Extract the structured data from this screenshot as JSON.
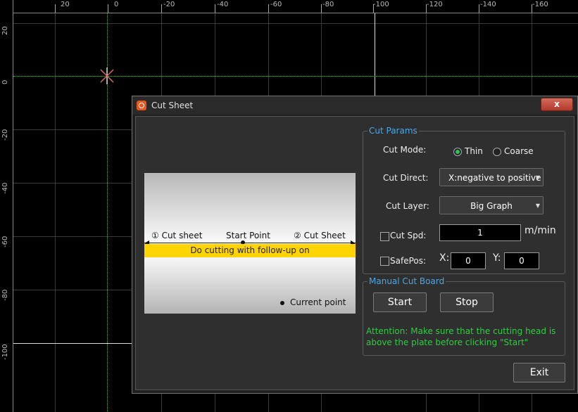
{
  "ruler": {
    "top_labels": [
      "20",
      "0",
      "-20",
      "-40",
      "-60",
      "-80",
      "-100",
      "-120",
      "-140",
      "-160"
    ],
    "left_labels": [
      "20",
      "0",
      "-20",
      "-40",
      "-60",
      "-80",
      "-100"
    ]
  },
  "dialog": {
    "title": "Cut Sheet",
    "close": "x",
    "preview": {
      "cut_sheet_1": "① Cut sheet",
      "start_point": "Start Point",
      "cut_sheet_2": "② Cut Sheet",
      "band_text": "Do cutting with follow-up on",
      "current_point": "Current point"
    },
    "cut_params": {
      "title": "Cut Params",
      "cut_mode_label": "Cut Mode:",
      "mode_thin": "Thin",
      "mode_coarse": "Coarse",
      "cut_direct_label": "Cut Direct:",
      "cut_direct_value": "X:negative to positive",
      "cut_layer_label": "Cut Layer:",
      "cut_layer_value": "Big Graph",
      "cut_spd_label": "Cut Spd:",
      "cut_spd_value": "1",
      "cut_spd_unit": "m/min",
      "safepos_label": "SafePos:",
      "x_label": "X:",
      "x_value": "0",
      "y_label": "Y:",
      "y_value": "0"
    },
    "manual": {
      "title": "Manual Cut Board",
      "start": "Start",
      "stop": "Stop",
      "attention": "Attention: Make sure that the cutting head is above the plate before clicking \"Start\""
    },
    "exit": "Exit"
  },
  "colors": {
    "accent_title": "#4aa8e8",
    "attention": "#2ecc40",
    "radio_on": "#22c55e",
    "band": "#ffd400"
  }
}
